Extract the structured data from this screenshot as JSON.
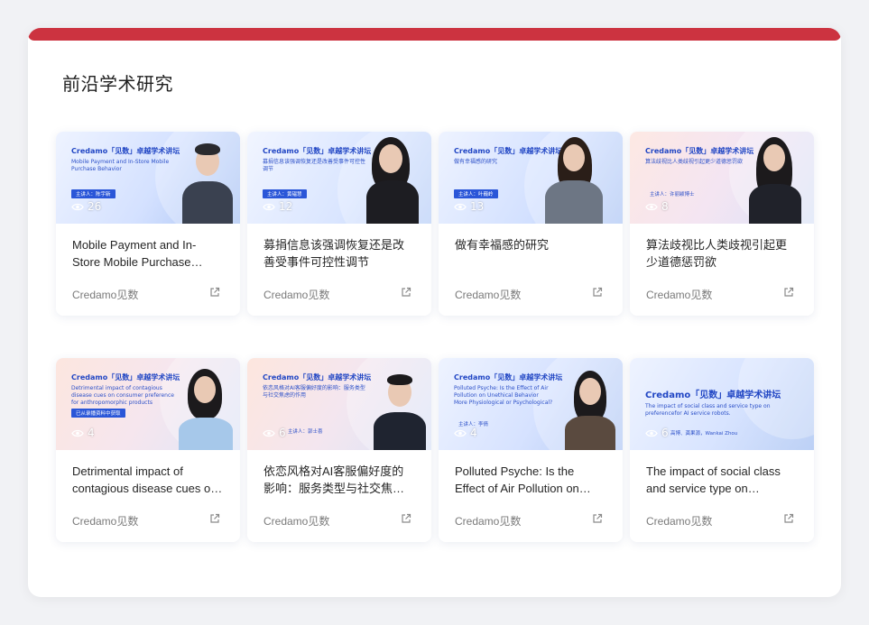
{
  "section": {
    "title": "前沿学术研究"
  },
  "cards": [
    {
      "title": "Mobile Payment and In-Store Mobile Purchase Behavior",
      "views": "26",
      "source": "Credamo见数",
      "thumb": {
        "brand": "Credamo「见数」卓越学术讲坛",
        "subtitle": "Mobile Payment and In-Store Mobile Purchase Behavior",
        "speaker": "主讲人：陈宇新"
      }
    },
    {
      "title": "募捐信息该强调恢复还是改善受事件可控性调节",
      "views": "12",
      "source": "Credamo见数",
      "thumb": {
        "brand": "Credamo「见数」卓越学术讲坛",
        "subtitle": "募捐信息该强调恢复还是改善受事件可控性调节",
        "speaker": "主讲人：黄韫慧"
      }
    },
    {
      "title": "做有幸福感的研究",
      "views": "13",
      "source": "Credamo见数",
      "thumb": {
        "brand": "Credamo「见数」卓越学术讲坛",
        "subtitle": "做有幸福感的研究",
        "speaker": "主讲人：叶巍岭"
      }
    },
    {
      "title": "算法歧视比人类歧视引起更少道德惩罚欲",
      "views": "8",
      "source": "Credamo见数",
      "thumb": {
        "brand": "Credamo「见数」卓越学术讲坛",
        "subtitle": "算法歧视比人类歧视引起更少道德惩罚欲",
        "speaker": "主讲人：许丽颖博士"
      }
    },
    {
      "title": "Detrimental impact of contagious disease cues on consumer preference",
      "views": "4",
      "source": "Credamo见数",
      "thumb": {
        "brand": "Credamo「见数」卓越学术讲坛",
        "subtitle": "Detrimental impact of contagious disease cues on consumer preference for anthropomorphic products",
        "speaker": "已从录播资料中获取"
      }
    },
    {
      "title": "依恋风格对AI客服偏好度的影响：服务类型与社交焦虑的作用",
      "views": "6",
      "source": "Credamo见数",
      "thumb": {
        "brand": "Credamo「见数」卓越学术讲坛",
        "subtitle": "依恋风格对AI客服偏好度的影响：服务类型与社交焦虑的作用",
        "speaker": "主讲人：郭士喜"
      }
    },
    {
      "title": "Polluted Psyche: Is the Effect of Air Pollution on Unethical Behavior More Physiological or Psychological?",
      "views": "4",
      "source": "Credamo见数",
      "thumb": {
        "brand": "Credamo「见数」卓越学术讲坛",
        "subtitle": "Polluted Psyche: Is the Effect of Air Pollution on Unethical Behavior More Physiological or Psychological?",
        "speaker": "主讲人：李倩"
      }
    },
    {
      "title": "The impact of social class and service type on preference for AI service robots",
      "views": "6",
      "source": "Credamo见数",
      "thumb": {
        "brand": "Credamo「见数」卓越学术讲坛",
        "subtitle": "The impact of social class and service type on preferencefor AI service robots.",
        "speaker": "高博、龚果源，Wankai Zhou"
      }
    }
  ],
  "colors": {
    "accent_bar": "#cc3340",
    "card_bg": "#ffffff",
    "title_text": "#262626",
    "meta_text": "#7a7a7a"
  }
}
